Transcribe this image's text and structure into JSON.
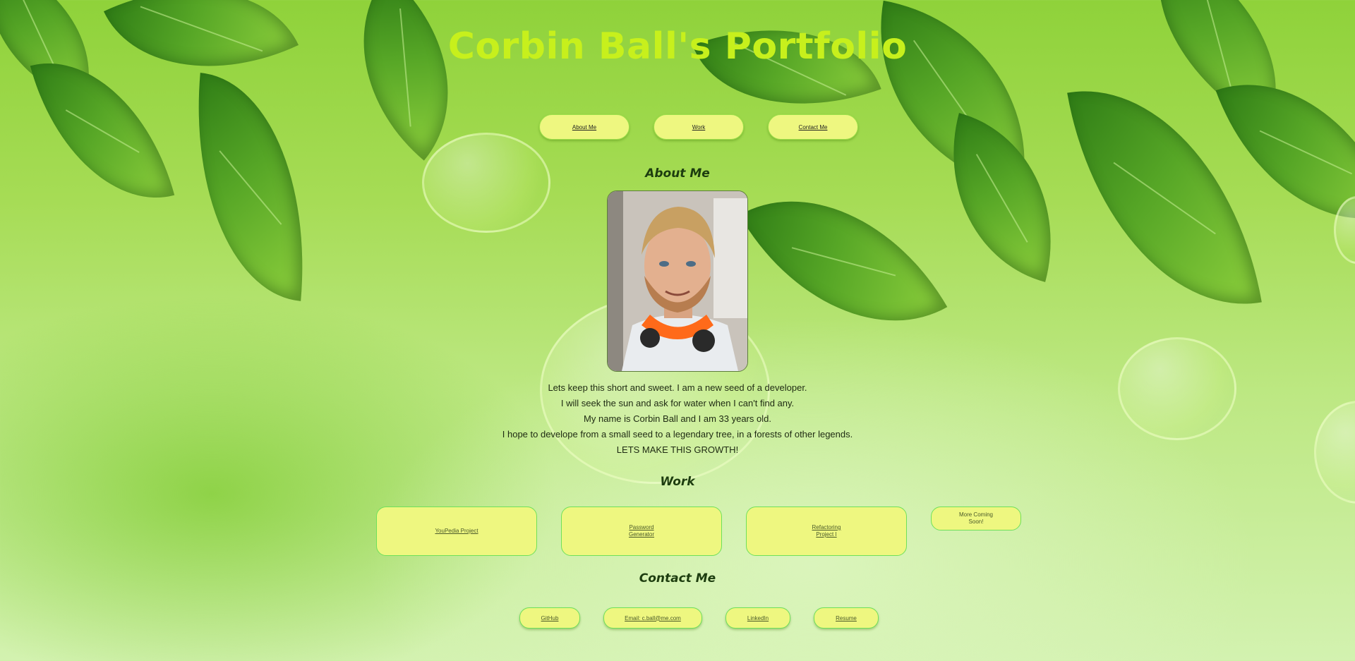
{
  "header": {
    "title": "Corbin Ball's Portfolio"
  },
  "nav": {
    "items": [
      {
        "label": "About Me"
      },
      {
        "label": "Work"
      },
      {
        "label": "Contact Me"
      }
    ]
  },
  "about": {
    "heading": "About Me",
    "photo_icon": "portrait-photo",
    "lines": [
      "Lets keep this short and sweet. I am a new seed of a developer.",
      "I will seek the sun and ask for water when I can't find any.",
      "My name is Corbin Ball and I am 33 years old.",
      "I hope to develope from a small seed to a legendary tree, in a forests of other legends.",
      "LETS MAKE THIS GROWTH!"
    ]
  },
  "work": {
    "heading": "Work",
    "projects": [
      {
        "label": "YouPedia Project"
      },
      {
        "label": "Password Generator"
      },
      {
        "label": "Refactoring Project I"
      },
      {
        "label": "More Coming Soon!"
      }
    ]
  },
  "contact": {
    "heading": "Contact Me",
    "links": [
      {
        "label": "GitHub"
      },
      {
        "label": "Email: c.ball@me.com"
      },
      {
        "label": "LinkedIn"
      },
      {
        "label": "Resume"
      }
    ]
  },
  "colors": {
    "title": "#c7f01c",
    "button_bg": "#eef780",
    "button_border": "#6ee05a",
    "background_green": "#a6dc55"
  }
}
